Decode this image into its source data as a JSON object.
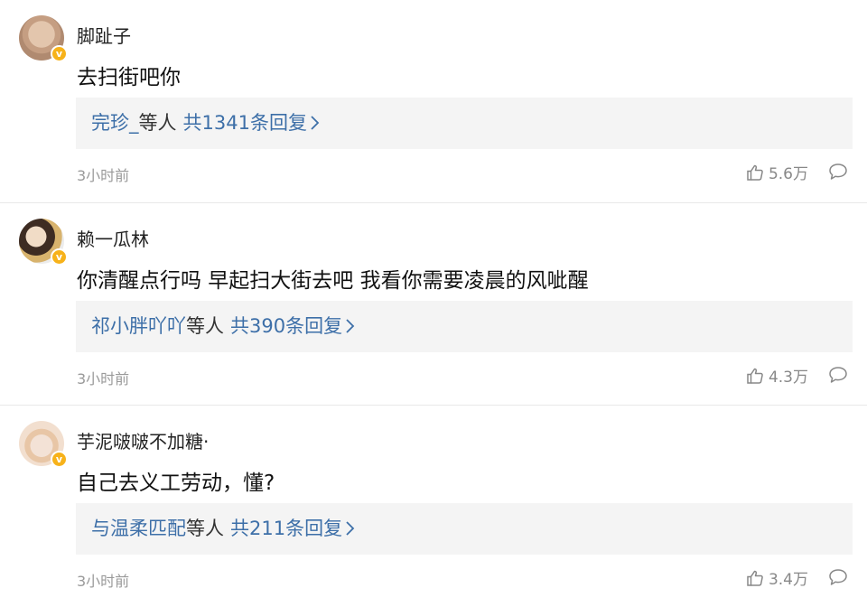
{
  "comments": [
    {
      "author": "脚趾子",
      "text": "去扫街吧你",
      "replies": {
        "names": "完珍_",
        "mid": "等人",
        "count_label": "共1341条回复"
      },
      "time": "3小时前",
      "likes": "5.6万",
      "badge": "v"
    },
    {
      "author": "赖一瓜林",
      "text": "你清醒点行吗 早起扫大街去吧 我看你需要凌晨的风呲醒",
      "replies": {
        "names": "祁小胖吖吖",
        "mid": "等人",
        "count_label": "共390条回复"
      },
      "time": "3小时前",
      "likes": "4.3万",
      "badge": "v"
    },
    {
      "author": "芋泥啵啵不加糖·",
      "text": "自己去义工劳动，懂?",
      "replies": {
        "names": "与温柔匹配",
        "mid": "等人",
        "count_label": "共211条回复"
      },
      "time": "3小时前",
      "likes": "3.4万",
      "badge": "v"
    }
  ],
  "icons": {
    "like": "thumbs-up-icon",
    "reply": "comment-bubble-icon",
    "chevron": "chevron-right-icon"
  },
  "colors": {
    "link": "#3d6fa8",
    "verified_badge": "#f7b21a",
    "reply_box_bg": "#f4f4f4",
    "meta_text": "#9a9a9a"
  }
}
